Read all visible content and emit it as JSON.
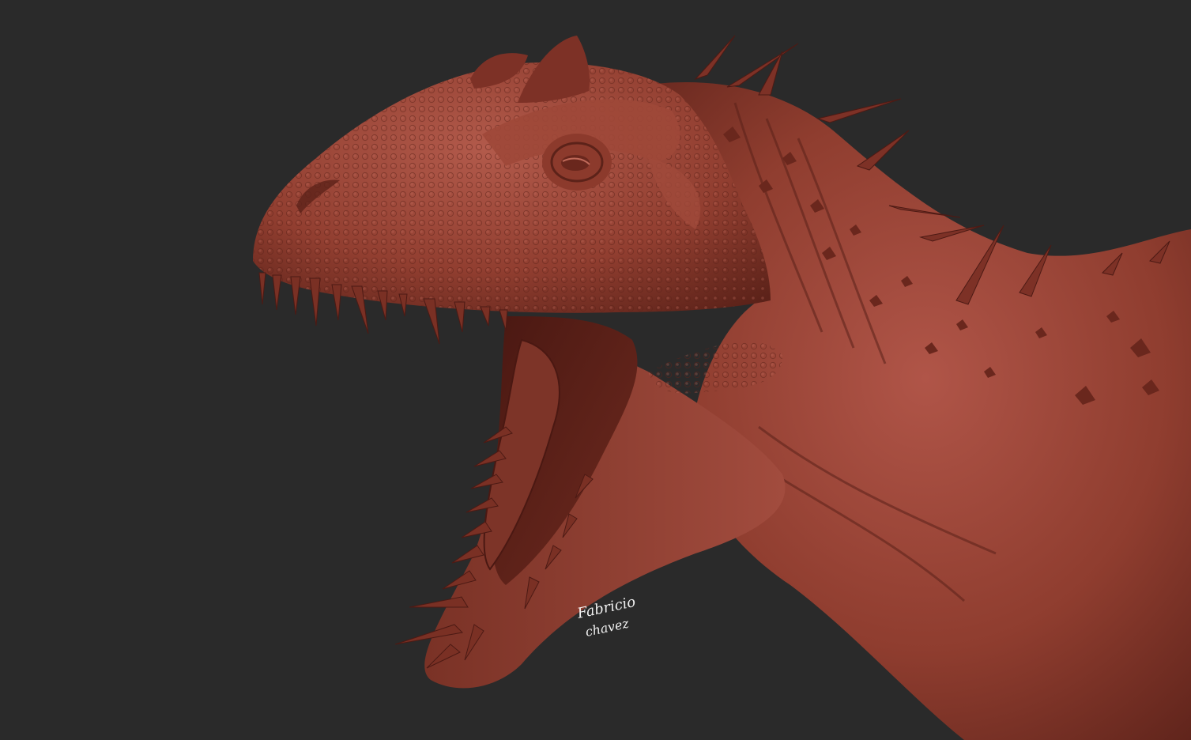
{
  "scene": {
    "subject": "dinosaur-sculpt",
    "background_color": "#2a2a2a",
    "clay_base": "#8a3a2c",
    "clay_light": "#b4574a",
    "clay_dark": "#4c1a14",
    "tooth_color": "#7a3024"
  },
  "signature": {
    "text_line1": "Fabricio",
    "text_line2": "chavez"
  }
}
